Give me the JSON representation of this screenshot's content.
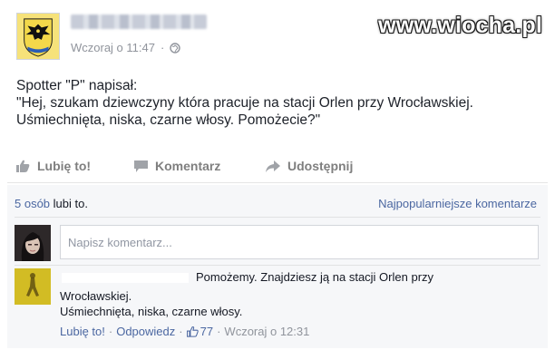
{
  "watermark": "www.wiocha.pl",
  "post": {
    "timestamp": "Wczoraj o 11:47",
    "separator": "·",
    "text_lines": [
      "Spotter \"P\" napisał:",
      "\"Hej, szukam dziewczyny która pracuje na stacji Orlen przy Wrocławskiej.",
      "Uśmiechnięta, niska, czarne włosy. Pomożecie?\""
    ]
  },
  "actions": {
    "like": "Lubię to!",
    "comment": "Komentarz",
    "share": "Udostępnij"
  },
  "likes": {
    "count_text": "5 osób",
    "suffix": "lubi to."
  },
  "top_comments_label": "Najpopularniejsze komentarze",
  "comment_input": {
    "placeholder": "Napisz komentarz..."
  },
  "comment": {
    "lines": [
      "Pomożemy. Znajdziesz ją na stacji Orlen przy",
      "Wrocławskiej.",
      "Uśmiechnięta, niska, czarne włosy."
    ],
    "like_label": "Lubię to!",
    "reply_label": "Odpowiedz",
    "like_count": "77",
    "time": "Wczoraj o 12:31",
    "sep": "·"
  },
  "colors": {
    "link_blue": "#4b67a1",
    "muted_gray": "#90949c",
    "action_gray": "#7f7f7f",
    "comment_bg": "#f6f7f9"
  }
}
